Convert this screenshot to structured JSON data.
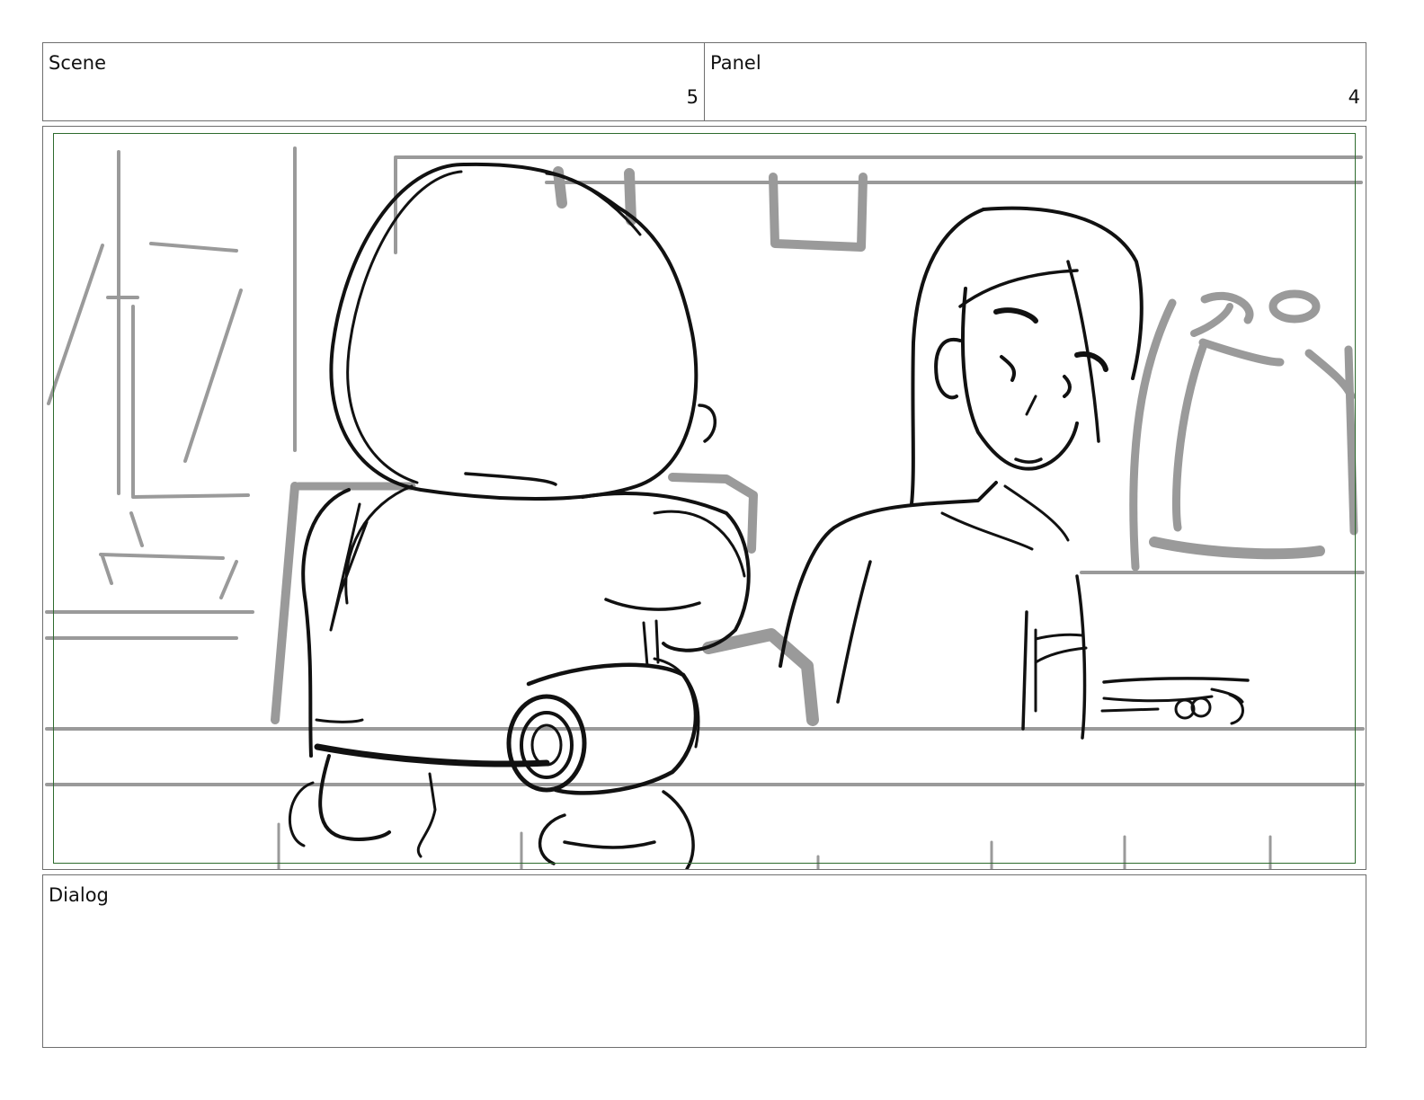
{
  "header": {
    "scene_label": "Scene",
    "scene_number": "5",
    "panel_label": "Panel",
    "panel_number": "4"
  },
  "dialog": {
    "label": "Dialog",
    "text": ""
  },
  "colors": {
    "border": "#6e6e6e",
    "safe_frame": "#2e6b2e",
    "sketch_ink": "#111111",
    "background_sketch": "#9a9a9a"
  }
}
